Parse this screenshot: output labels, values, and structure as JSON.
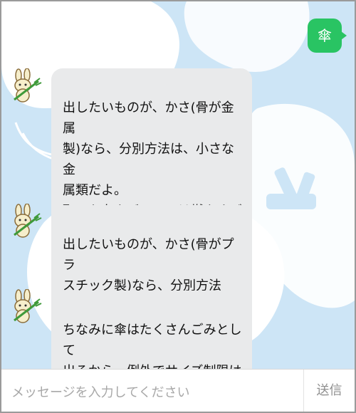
{
  "colors": {
    "chat_background": "#cde5f6",
    "user_bubble": "#29c463",
    "bot_bubble": "#e9eaeb",
    "send_text": "#8f8f8f"
  },
  "user_message": {
    "text": "傘"
  },
  "bot_messages": [
    {
      "text": "出したいものが、かさ(骨が金属\n製)なら、分別方法は、小さな金\n属類だよ。\n取った布やビニールは燃やすごみ\nに出してね。持ち手はつけたまま\n出すことができるよ。"
    },
    {
      "text": "出したいものが、かさ(骨がプラ\nスチック製)なら、分別方法は、\n燃やすごみだよ。"
    },
    {
      "text": "ちなみに傘はたくさんごみとして\n出るから、例外でサイズ制限はし\nてないんだ。"
    }
  ],
  "input": {
    "placeholder": "メッセージを入力してください",
    "value": ""
  },
  "send_button": {
    "label": "送信"
  },
  "avatar_icon": "rabbit-mascot-icon"
}
